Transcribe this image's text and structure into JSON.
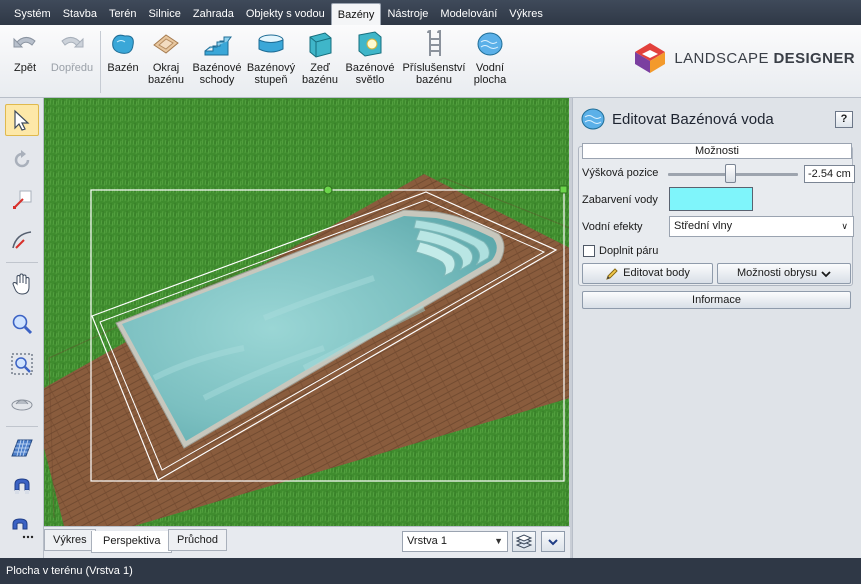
{
  "menu": {
    "items": [
      "Systém",
      "Stavba",
      "Terén",
      "Silnice",
      "Zahrada",
      "Objekty s vodou",
      "Bazény",
      "Nástroje",
      "Modelování",
      "Výkres"
    ],
    "active_index": 6
  },
  "ribbon": {
    "undo": "Zpět",
    "redo": "Dopředu",
    "pool": [
      "Bazén"
    ],
    "pool_edge": [
      "Okraj",
      "bazénu"
    ],
    "pool_stairs": [
      "Bazénové",
      "schody"
    ],
    "pool_step": [
      "Bazénový",
      "stupeň"
    ],
    "pool_wall": [
      "Zeď",
      "bazénu"
    ],
    "pool_light": [
      "Bazénové",
      "světlo"
    ],
    "pool_accessories": [
      "Příslušenství",
      "bazénu"
    ],
    "water_surface": [
      "Vodní",
      "plocha"
    ]
  },
  "logo": {
    "brand_light": "LANDSCAPE ",
    "brand_bold": "DESIGNER"
  },
  "view_tabs": {
    "drawing": "Výkres",
    "perspective": "Perspektiva",
    "walkthrough": "Průchod"
  },
  "layer": {
    "selected": "Vrstva 1"
  },
  "panel": {
    "title": "Editovat Bazénová voda",
    "help": "?",
    "options_title": "Možnosti",
    "height_label": "Výšková pozice",
    "height_value": "-2.54 cm",
    "height_slider_fraction": 0.48,
    "water_color_label": "Zabarvení vody",
    "water_color": "#7ff5fb",
    "effects_label": "Vodní efekty",
    "effects_value": "Střední vlny",
    "steam_label": "Doplnit páru",
    "steam_checked": false,
    "edit_points": "Editovat body",
    "outline_options": "Možnosti obrysu",
    "info": "Informace"
  },
  "status": {
    "text": "Plocha v terénu (Vrstva 1)"
  },
  "colors": {
    "accent_selected": "#fde8a8",
    "grass": "#3d8a2d",
    "deck": "#8a5a3c",
    "water": "#7bc3c4"
  }
}
